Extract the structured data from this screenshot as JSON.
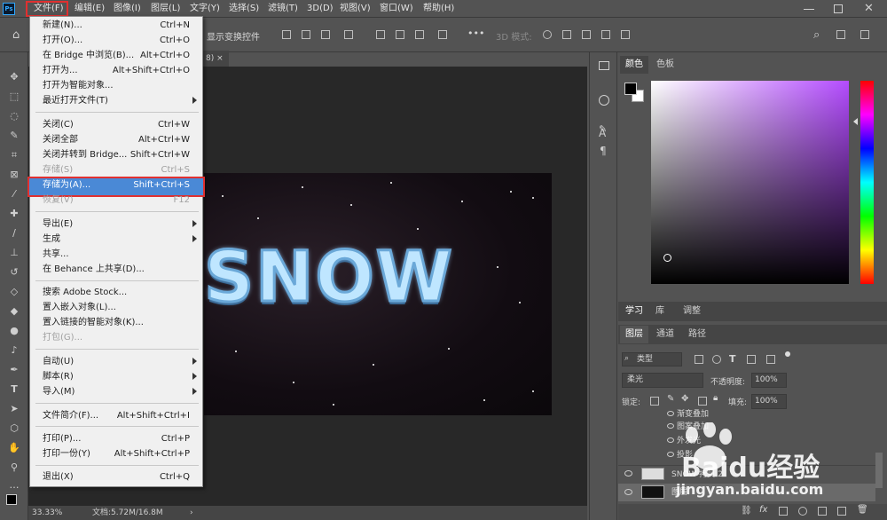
{
  "menubar": {
    "logo": "Ps",
    "items": [
      "文件(F)",
      "编辑(E)",
      "图像(I)",
      "图层(L)",
      "文字(Y)",
      "选择(S)",
      "滤镜(T)",
      "3D(D)",
      "视图(V)",
      "窗口(W)",
      "帮助(H)"
    ]
  },
  "optbar": {
    "show_transform": "显示变换控件",
    "mode_3d": "3D 模式:",
    "more": "•••"
  },
  "doc_tab": {
    "label": "8)",
    "close": "×"
  },
  "file_menu": {
    "items": [
      {
        "label": "新建(N)...",
        "shortcut": "Ctrl+N",
        "disabled": false,
        "submenu": false
      },
      {
        "label": "打开(O)...",
        "shortcut": "Ctrl+O",
        "disabled": false,
        "submenu": false
      },
      {
        "label": "在 Bridge 中浏览(B)...",
        "shortcut": "Alt+Ctrl+O",
        "disabled": false,
        "submenu": false
      },
      {
        "label": "打开为...",
        "shortcut": "Alt+Shift+Ctrl+O",
        "disabled": false,
        "submenu": false
      },
      {
        "label": "打开为智能对象...",
        "shortcut": "",
        "disabled": false,
        "submenu": false
      },
      {
        "label": "最近打开文件(T)",
        "shortcut": "",
        "disabled": false,
        "submenu": true
      },
      {
        "label": "关闭(C)",
        "shortcut": "Ctrl+W",
        "disabled": false,
        "submenu": false
      },
      {
        "label": "关闭全部",
        "shortcut": "Alt+Ctrl+W",
        "disabled": false,
        "submenu": false
      },
      {
        "label": "关闭并转到 Bridge...",
        "shortcut": "Shift+Ctrl+W",
        "disabled": false,
        "submenu": false
      },
      {
        "label": "存储(S)",
        "shortcut": "Ctrl+S",
        "disabled": true,
        "submenu": false
      },
      {
        "label": "存储为(A)...",
        "shortcut": "Shift+Ctrl+S",
        "disabled": false,
        "submenu": false
      },
      {
        "label": "恢复(V)",
        "shortcut": "F12",
        "disabled": true,
        "submenu": false
      },
      {
        "label": "导出(E)",
        "shortcut": "",
        "disabled": false,
        "submenu": true
      },
      {
        "label": "生成",
        "shortcut": "",
        "disabled": false,
        "submenu": true
      },
      {
        "label": "共享...",
        "shortcut": "",
        "disabled": false,
        "submenu": false
      },
      {
        "label": "在 Behance 上共享(D)...",
        "shortcut": "",
        "disabled": false,
        "submenu": false
      },
      {
        "label": "搜索 Adobe Stock...",
        "shortcut": "",
        "disabled": false,
        "submenu": false
      },
      {
        "label": "置入嵌入对象(L)...",
        "shortcut": "",
        "disabled": false,
        "submenu": false
      },
      {
        "label": "置入链接的智能对象(K)...",
        "shortcut": "",
        "disabled": false,
        "submenu": false
      },
      {
        "label": "打包(G)...",
        "shortcut": "",
        "disabled": true,
        "submenu": false
      },
      {
        "label": "自动(U)",
        "shortcut": "",
        "disabled": false,
        "submenu": true
      },
      {
        "label": "脚本(R)",
        "shortcut": "",
        "disabled": false,
        "submenu": true
      },
      {
        "label": "导入(M)",
        "shortcut": "",
        "disabled": false,
        "submenu": true
      },
      {
        "label": "文件简介(F)...",
        "shortcut": "Alt+Shift+Ctrl+I",
        "disabled": false,
        "submenu": false
      },
      {
        "label": "打印(P)...",
        "shortcut": "Ctrl+P",
        "disabled": false,
        "submenu": false
      },
      {
        "label": "打印一份(Y)",
        "shortcut": "Alt+Shift+Ctrl+P",
        "disabled": false,
        "submenu": false
      },
      {
        "label": "退出(X)",
        "shortcut": "Ctrl+Q",
        "disabled": false,
        "submenu": false
      }
    ]
  },
  "canvas": {
    "artwork_text": "SNOW"
  },
  "statusbar": {
    "zoom": "33.33%",
    "doc": "文档:5.72M/16.8M"
  },
  "color_panel": {
    "tabs": [
      "颜色",
      "色板"
    ]
  },
  "learn_panel": {
    "tabs": [
      "学习",
      "库",
      "调整"
    ]
  },
  "layers_panel": {
    "tabs": [
      "图层",
      "通道",
      "路径"
    ],
    "filter_kind": "类型",
    "blend_mode": "柔光",
    "opacity_label": "不透明度:",
    "opacity_value": "100%",
    "lock_label": "锁定:",
    "fill_label": "填充:",
    "fill_value": "100%",
    "effects": [
      "渐变叠加",
      "图案叠加",
      "外发光",
      "投影"
    ],
    "layers": [
      "SNOW 拷贝 2",
      "图层"
    ]
  },
  "watermark": {
    "brand": "Baidu经验",
    "url": "jingyan.baidu.com"
  },
  "colors": {
    "bg": "#535353",
    "canvas": "#282828",
    "highlight": "#e03030",
    "selection": "#4a89d6",
    "hue_start": "#ff0000",
    "field_hue": "#b44cff"
  }
}
